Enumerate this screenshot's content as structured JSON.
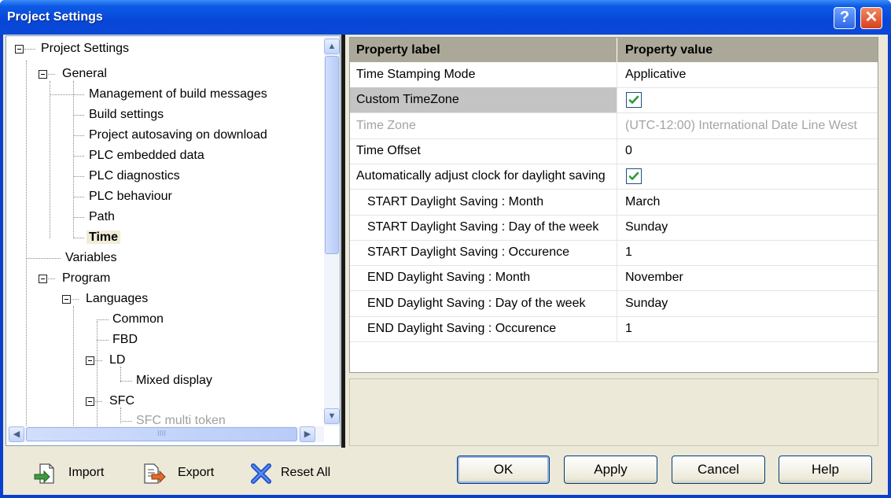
{
  "window": {
    "title": "Project Settings",
    "help_icon": "?",
    "close_icon": "✕"
  },
  "tree": {
    "items": [
      {
        "label": "Project Settings"
      },
      {
        "label": "General"
      },
      {
        "label": "Management of build messages"
      },
      {
        "label": "Build settings"
      },
      {
        "label": "Project autosaving on download"
      },
      {
        "label": "PLC embedded data"
      },
      {
        "label": "PLC diagnostics"
      },
      {
        "label": "PLC behaviour"
      },
      {
        "label": "Path"
      },
      {
        "label": "Time"
      },
      {
        "label": "Variables"
      },
      {
        "label": "Program"
      },
      {
        "label": "Languages"
      },
      {
        "label": "Common"
      },
      {
        "label": "FBD"
      },
      {
        "label": "LD"
      },
      {
        "label": "Mixed display"
      },
      {
        "label": "SFC"
      },
      {
        "label": "SFC multi token"
      }
    ],
    "selected": "Time",
    "hscroll_grip": "IIII"
  },
  "grid": {
    "headers": {
      "label": "Property label",
      "value": "Property value"
    },
    "rows": [
      {
        "label": "Time Stamping Mode",
        "value": "Applicative"
      },
      {
        "label": "Custom TimeZone",
        "value": "",
        "checked": true
      },
      {
        "label": "Time Zone",
        "value": "(UTC-12:00) International Date Line West"
      },
      {
        "label": "Time Offset",
        "value": "0"
      },
      {
        "label": "Automatically adjust clock for daylight saving",
        "value": "",
        "checked": true
      },
      {
        "label": "START Daylight Saving : Month",
        "value": "March"
      },
      {
        "label": "START Daylight Saving : Day of the week",
        "value": "Sunday"
      },
      {
        "label": "START Daylight Saving : Occurence",
        "value": "1"
      },
      {
        "label": "END Daylight Saving : Month",
        "value": "November"
      },
      {
        "label": "END Daylight Saving : Day of the week",
        "value": "Sunday"
      },
      {
        "label": "END Daylight Saving : Occurence",
        "value": "1"
      }
    ]
  },
  "actions": {
    "import": "Import",
    "export": "Export",
    "reset_all": "Reset All",
    "ok": "OK",
    "apply": "Apply",
    "cancel": "Cancel",
    "help": "Help"
  },
  "colors": {
    "title_bar": "#0a48d8",
    "dialog_bg": "#ece9d8",
    "grid_header": "#aca899",
    "selected_row": "#c4c4c4",
    "check_green": "#2b9a3a"
  }
}
